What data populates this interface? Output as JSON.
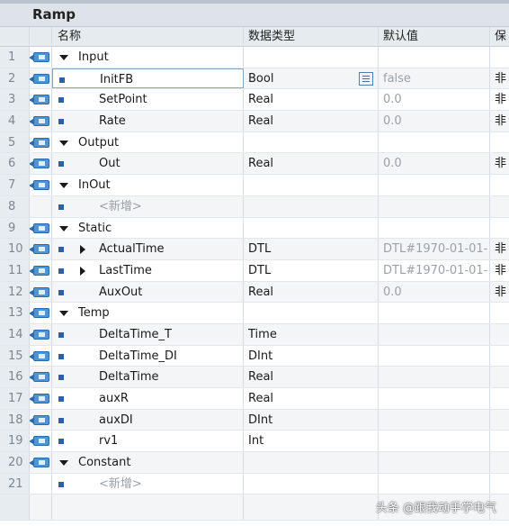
{
  "window": {
    "title": "Ramp"
  },
  "columns": {
    "name": "名称",
    "datatype": "数据类型",
    "default": "默认值",
    "retain": "保"
  },
  "rows": [
    {
      "num": "1",
      "kind": "section",
      "name": "Input"
    },
    {
      "num": "2",
      "kind": "var",
      "name": "InitFB",
      "type": "Bool",
      "default": "false",
      "retain": "非",
      "editing": true
    },
    {
      "num": "3",
      "kind": "var",
      "name": "SetPoint",
      "type": "Real",
      "default": "0.0",
      "retain": "非"
    },
    {
      "num": "4",
      "kind": "var",
      "name": "Rate",
      "type": "Real",
      "default": "0.0",
      "retain": "非"
    },
    {
      "num": "5",
      "kind": "section",
      "name": "Output"
    },
    {
      "num": "6",
      "kind": "var",
      "name": "Out",
      "type": "Real",
      "default": "0.0",
      "retain": "非"
    },
    {
      "num": "7",
      "kind": "section",
      "name": "InOut"
    },
    {
      "num": "8",
      "kind": "add",
      "name": "<新增>"
    },
    {
      "num": "9",
      "kind": "section",
      "name": "Static"
    },
    {
      "num": "10",
      "kind": "struct",
      "name": "ActualTime",
      "type": "DTL",
      "default": "DTL#1970-01-01-",
      "retain": "非"
    },
    {
      "num": "11",
      "kind": "struct",
      "name": "LastTime",
      "type": "DTL",
      "default": "DTL#1970-01-01-",
      "retain": "非"
    },
    {
      "num": "12",
      "kind": "var",
      "name": "AuxOut",
      "type": "Real",
      "default": "0.0",
      "retain": "非"
    },
    {
      "num": "13",
      "kind": "section",
      "name": "Temp"
    },
    {
      "num": "14",
      "kind": "var",
      "name": "DeltaTime_T",
      "type": "Time",
      "default": "",
      "retain": ""
    },
    {
      "num": "15",
      "kind": "var",
      "name": "DeltaTime_DI",
      "type": "DInt",
      "default": "",
      "retain": ""
    },
    {
      "num": "16",
      "kind": "var",
      "name": "DeltaTime",
      "type": "Real",
      "default": "",
      "retain": ""
    },
    {
      "num": "17",
      "kind": "var",
      "name": "auxR",
      "type": "Real",
      "default": "",
      "retain": ""
    },
    {
      "num": "18",
      "kind": "var",
      "name": "auxDI",
      "type": "DInt",
      "default": "",
      "retain": ""
    },
    {
      "num": "19",
      "kind": "var",
      "name": "rv1",
      "type": "Int",
      "default": "",
      "retain": ""
    },
    {
      "num": "20",
      "kind": "section",
      "name": "Constant"
    },
    {
      "num": "21",
      "kind": "add",
      "name": "<新增>"
    }
  ],
  "watermark": "头条 @跟我动手学电气",
  "icons": {
    "io": "interface-port-icon",
    "bullet": "variable-bullet-icon",
    "expand": "collapse-triangle-icon",
    "struct": "expand-triangle-icon",
    "droplist": "dropdown-list-icon"
  }
}
